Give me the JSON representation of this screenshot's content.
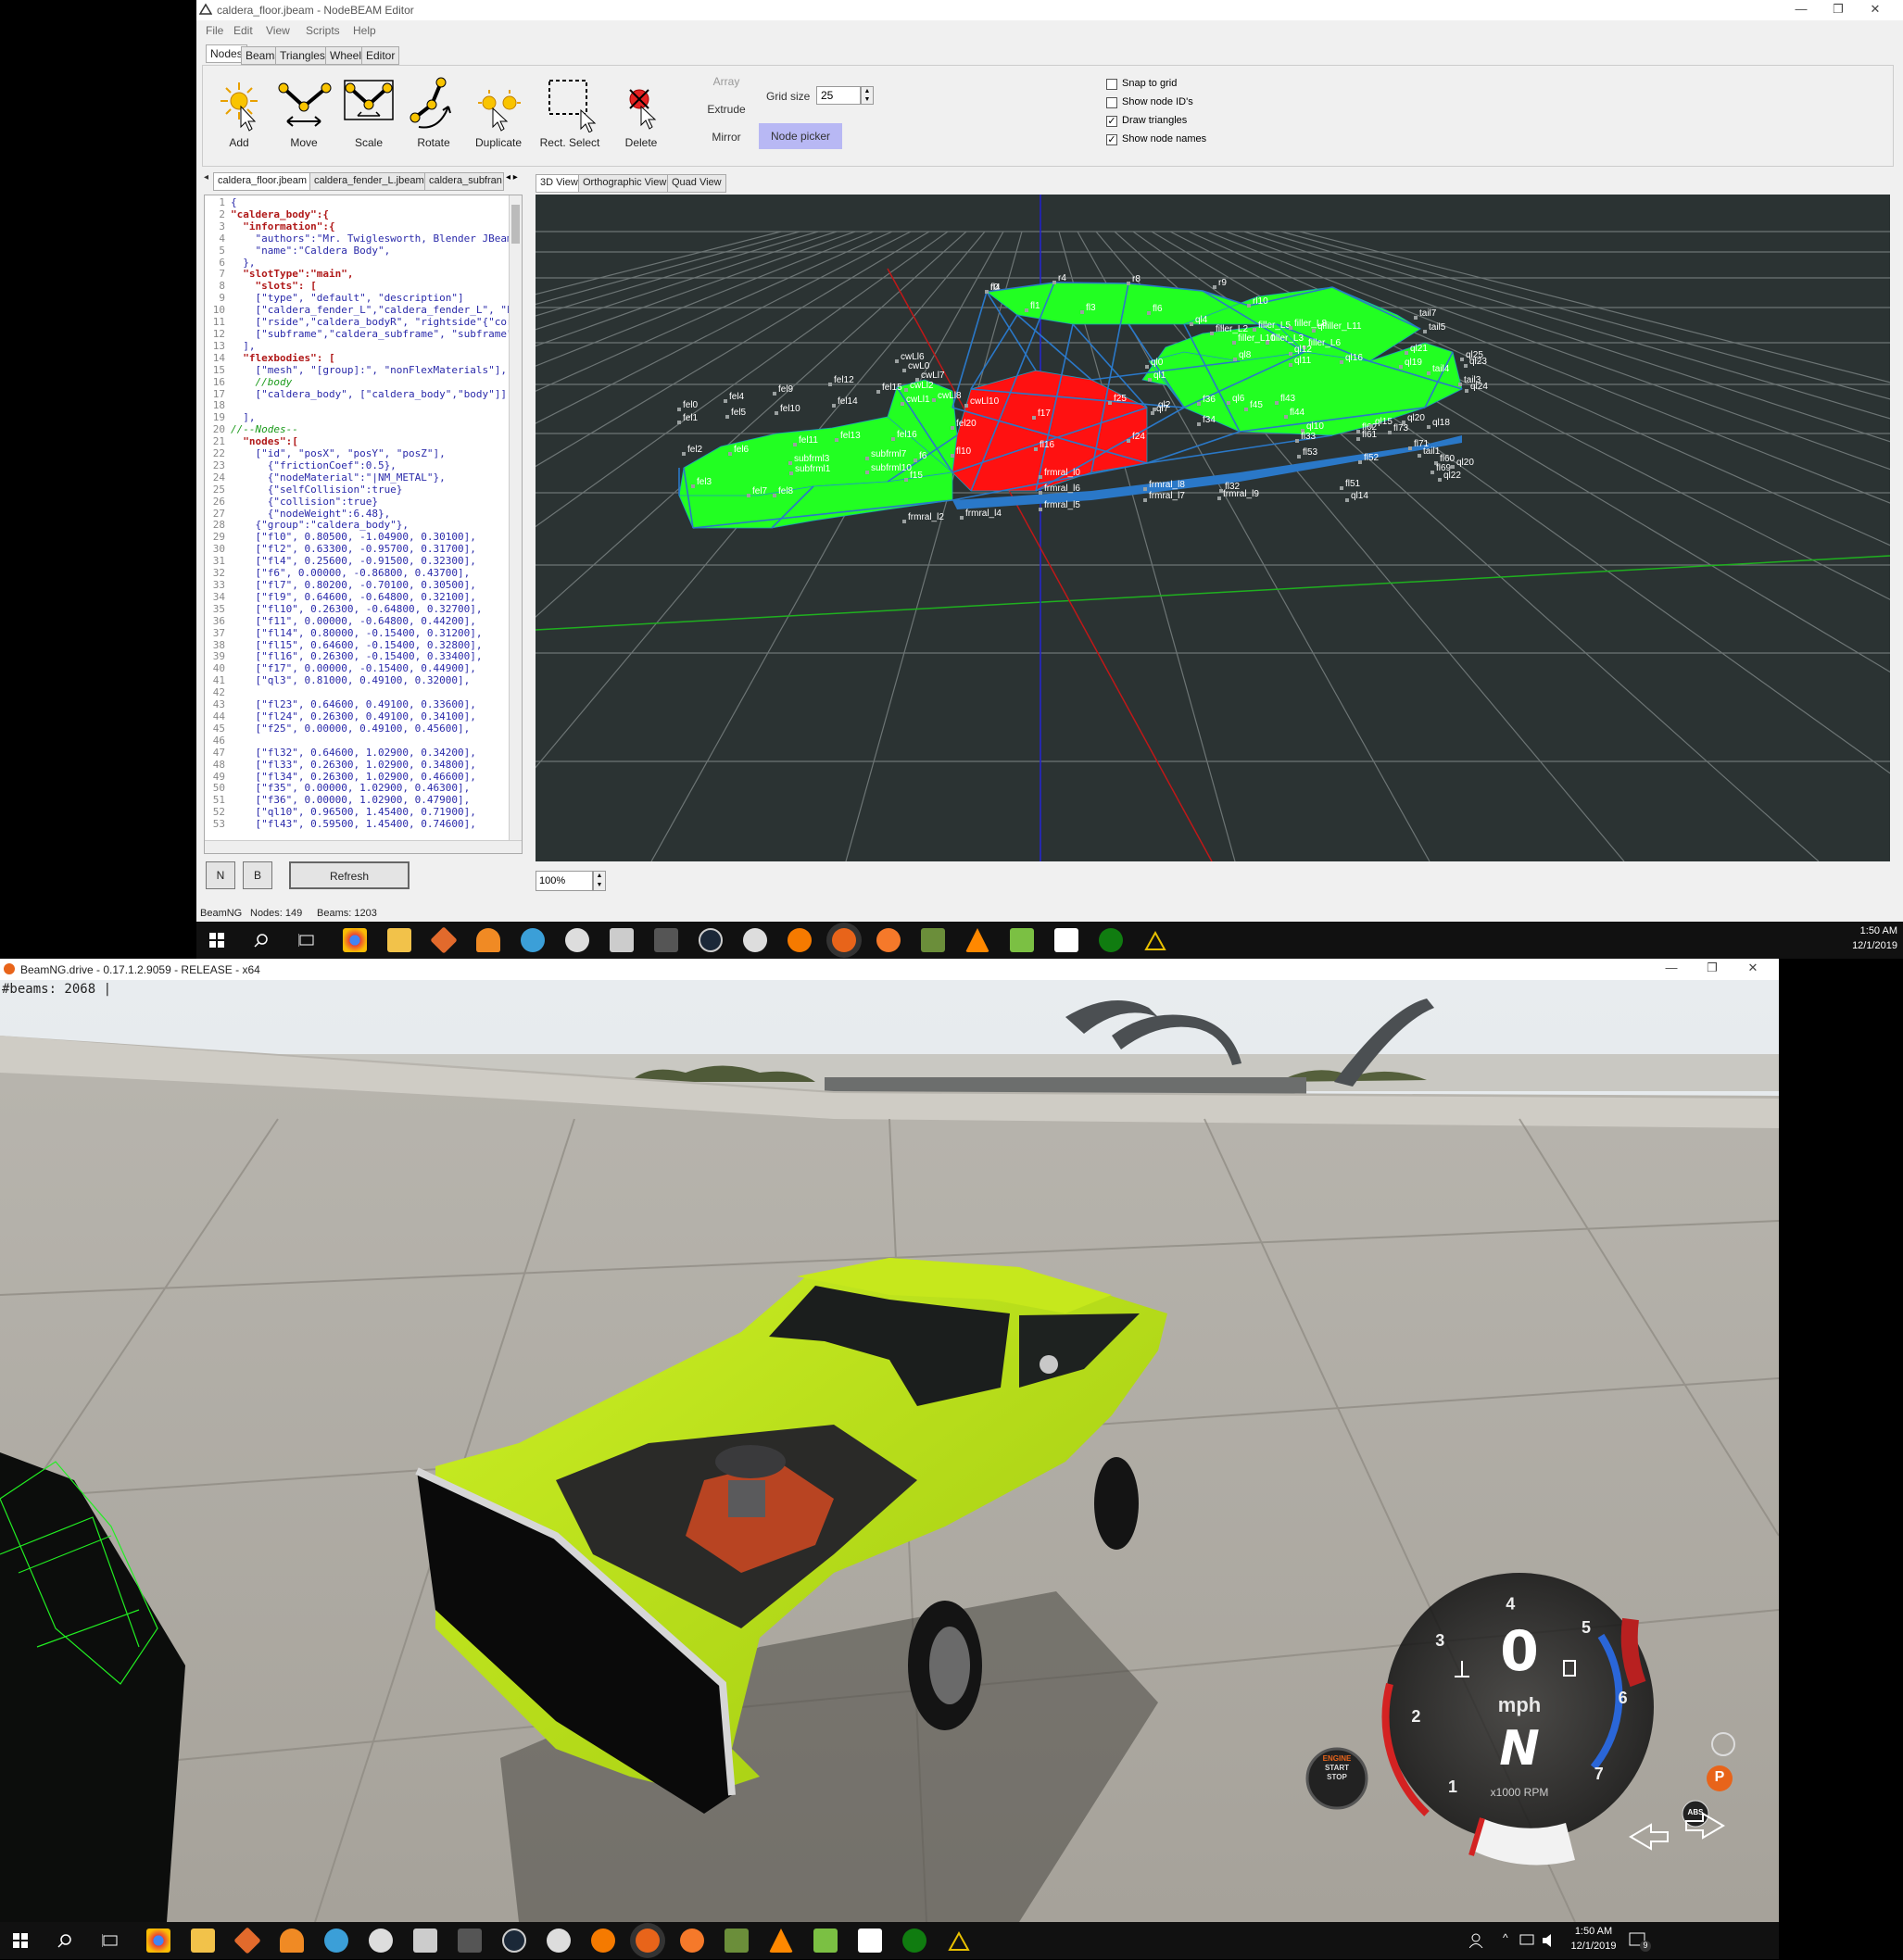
{
  "editor": {
    "title": "caldera_floor.jbeam - NodeBEAM Editor",
    "menu": [
      "File",
      "Edit",
      "View",
      "Scripts",
      "Help"
    ],
    "mode_tabs": [
      "Nodes",
      "Beams",
      "Triangles",
      "Wheels",
      "Editor"
    ],
    "tools": [
      "Add",
      "Move",
      "Scale",
      "Rotate",
      "Duplicate",
      "Rect. Select",
      "Delete"
    ],
    "array_label": "Array",
    "extrude_label": "Extrude",
    "mirror_label": "Mirror",
    "grid_size_label": "Grid size",
    "grid_size_value": "25",
    "node_picker_label": "Node picker",
    "options": [
      {
        "label": "Snap to grid",
        "checked": false
      },
      {
        "label": "Show node ID's",
        "checked": false
      },
      {
        "label": "Draw triangles",
        "checked": true
      },
      {
        "label": "Show node names",
        "checked": true
      }
    ],
    "file_tabs": [
      "caldera_floor.jbeam",
      "caldera_fender_L.jbeam",
      "caldera_subfran"
    ],
    "view_tabs": [
      "3D View",
      "Orthographic View",
      "Quad View"
    ],
    "code_lines": [
      "{",
      "\"caldera_body\":{",
      "  \"information\":{",
      "    \"authors\":\"Mr. Twiglesworth, Blender JBeam E",
      "    \"name\":\"Caldera Body\",",
      "  },",
      "  \"slotType\":\"main\",",
      "    \"slots\": [",
      "    [\"type\", \"default\", \"description\"]",
      "    [\"caldera_fender_L\",\"caldera_fender_L\", \"Left F",
      "    [\"rside\",\"caldera_bodyR\", \"rightside\"{\"coreSlo",
      "    [\"subframe\",\"caldera_subframe\", \"subframe\"{\"",
      "  ],",
      "  \"flexbodies\": [",
      "    [\"mesh\", \"[group]:\", \"nonFlexMaterials\"],",
      "    //body",
      "    [\"caldera_body\", [\"caldera_body\",\"body\"]],",
      "",
      "  ],",
      "//--Nodes--",
      "  \"nodes\":[",
      "    [\"id\", \"posX\", \"posY\", \"posZ\"],",
      "      {\"frictionCoef\":0.5},",
      "      {\"nodeMaterial\":\"|NM_METAL\"},",
      "      {\"selfCollision\":true}",
      "      {\"collision\":true}",
      "      {\"nodeWeight\":6.48},",
      "    {\"group\":\"caldera_body\"},",
      "    [\"fl0\", 0.80500, -1.04900, 0.30100],",
      "    [\"fl2\", 0.63300, -0.95700, 0.31700],",
      "    [\"fl4\", 0.25600, -0.91500, 0.32300],",
      "    [\"f6\", 0.00000, -0.86800, 0.43700],",
      "    [\"fl7\", 0.80200, -0.70100, 0.30500],",
      "    [\"fl9\", 0.64600, -0.64800, 0.32100],",
      "    [\"fl10\", 0.26300, -0.64800, 0.32700],",
      "    [\"f11\", 0.00000, -0.64800, 0.44200],",
      "    [\"fl14\", 0.80000, -0.15400, 0.31200],",
      "    [\"fl15\", 0.64600, -0.15400, 0.32800],",
      "    [\"fl16\", 0.26300, -0.15400, 0.33400],",
      "    [\"f17\", 0.00000, -0.15400, 0.44900],",
      "    [\"ql3\", 0.81000, 0.49100, 0.32000],",
      "",
      "    [\"fl23\", 0.64600, 0.49100, 0.33600],",
      "    [\"fl24\", 0.26300, 0.49100, 0.34100],",
      "    [\"f25\", 0.00000, 0.49100, 0.45600],",
      "",
      "    [\"fl32\", 0.64600, 1.02900, 0.34200],",
      "    [\"fl33\", 0.26300, 1.02900, 0.34800],",
      "    [\"fl34\", 0.26300, 1.02900, 0.46600],",
      "    [\"f35\", 0.00000, 1.02900, 0.46300],",
      "    [\"f36\", 0.00000, 1.02900, 0.47900],",
      "    [\"ql10\", 0.96500, 1.45400, 0.71900],",
      "    [\"fl43\", 0.59500, 1.45400, 0.74600],"
    ],
    "n_button": "N",
    "b_button": "B",
    "refresh_label": "Refresh",
    "zoom_value": "100%",
    "status": {
      "app": "BeamNG",
      "nodes": "Nodes: 149",
      "beams": "Beams: 1203"
    },
    "node_labels": [
      "r0",
      "r4",
      "r8",
      "r9",
      "rl10",
      "fl1",
      "fl3",
      "fl6",
      "ql4",
      "filler_L2",
      "filler_L5",
      "filler_L8",
      "qlfiller_L11",
      "tail7",
      "tail5",
      "filler_L10",
      "filler_L3",
      "filler_L6",
      "ql12",
      "ql8",
      "ql11",
      "ql16",
      "ql21",
      "ql25",
      "ql23",
      "ql19",
      "tail4",
      "tail3",
      "ql24",
      "cwLl6",
      "cwL0",
      "cwLl7",
      "cwLl2",
      "cwLl8",
      "cwLl10",
      "fel12",
      "fel15",
      "fel9",
      "fel4",
      "fel0",
      "fel1",
      "fel5",
      "fel10",
      "fel14",
      "cwLl1",
      "fel16",
      "fel11",
      "fel13",
      "fel2",
      "fel6",
      "fel3",
      "fel7",
      "fel8",
      "subfrml3",
      "subfrml1",
      "subfrml7",
      "subfrml10",
      "ql0",
      "ql1",
      "ql7",
      "f45",
      "fl43",
      "fl44",
      "ql10",
      "fl62",
      "fl73",
      "ql15",
      "ql20",
      "ql18",
      "f17",
      "f25",
      "fel20",
      "fl10",
      "fl16",
      "f24",
      "ql2",
      "f36",
      "ql6",
      "f34",
      "fl33",
      "fl53",
      "fl52",
      "fl61",
      "fl71",
      "tail1",
      "fl60",
      "ql20",
      "fl69",
      "ql22",
      "fl51",
      "ql14",
      "fl32",
      "frmral_l9",
      "frmral_l8",
      "frmral_l7",
      "frmral_l6",
      "frmral_l5",
      "frmral_l4",
      "frmral_l2",
      "frmral_l0",
      "f15",
      "f6",
      "fl4"
    ]
  },
  "taskbar_top": {
    "time": "1:50 AM",
    "date": "12/1/2019"
  },
  "game": {
    "title": "BeamNG.drive - 0.17.1.2.9059 - RELEASE - x64",
    "beams_readout": "#beams: 2068 |",
    "speed": "0",
    "speed_unit": "mph",
    "gear": "N",
    "rpm_unit": "x1000 RPM",
    "rpm_ticks": [
      "1",
      "2",
      "3",
      "4",
      "5",
      "6",
      "7"
    ],
    "engine_button": [
      "ENGINE",
      "START",
      "STOP"
    ],
    "parking_label": "P",
    "abs_label": "ABS"
  },
  "taskbar_bottom": {
    "time": "1:50 AM",
    "date": "12/1/2019",
    "notify_count": "9"
  },
  "colors": {
    "mesh_green": "#22ff22",
    "mesh_red": "#ff1111",
    "beam_blue": "#2a78c8",
    "car_body": "#b8e312",
    "viewport_bg": "#2b3333"
  }
}
